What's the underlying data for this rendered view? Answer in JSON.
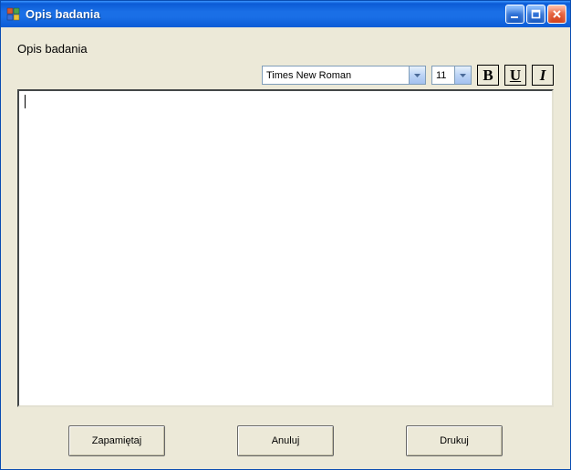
{
  "window": {
    "title": "Opis badania"
  },
  "heading": "Opis badania",
  "toolbar": {
    "font": "Times New Roman",
    "size": "11",
    "bold_label": "B",
    "underline_label": "U",
    "italic_label": "I"
  },
  "editor": {
    "content": ""
  },
  "buttons": {
    "save": "Zapamiętaj",
    "cancel": "Anuluj",
    "print": "Drukuj"
  }
}
